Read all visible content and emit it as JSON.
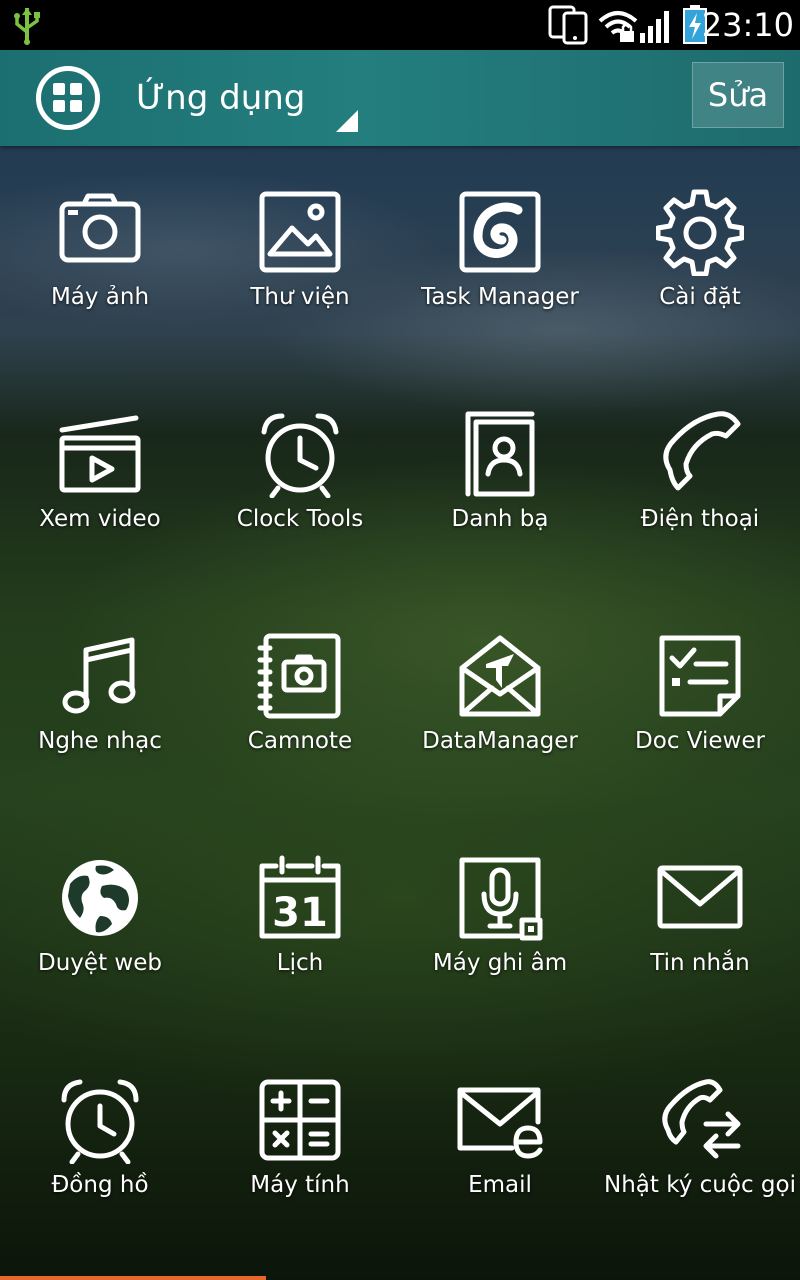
{
  "status_bar": {
    "time": "23:10",
    "icons": [
      "usb-icon",
      "screen-mirroring-icon",
      "wifi-lock-icon",
      "signal-icon",
      "battery-charging-icon"
    ]
  },
  "action_bar": {
    "title": "Ứng dụng",
    "edit_label": "Sửa",
    "accent_color": "#247e7e"
  },
  "apps": [
    {
      "label": "Máy ảnh",
      "icon": "camera-icon"
    },
    {
      "label": "Thư viện",
      "icon": "gallery-icon"
    },
    {
      "label": "Task Manager",
      "icon": "task-manager-icon"
    },
    {
      "label": "Cài đặt",
      "icon": "settings-gear-icon"
    },
    {
      "label": "Xem video",
      "icon": "video-player-icon"
    },
    {
      "label": "Clock Tools",
      "icon": "alarm-clock-icon"
    },
    {
      "label": "Danh bạ",
      "icon": "contacts-icon"
    },
    {
      "label": "Điện thoại",
      "icon": "phone-icon"
    },
    {
      "label": "Nghe nhạc",
      "icon": "music-note-icon"
    },
    {
      "label": "Camnote",
      "icon": "camnote-icon"
    },
    {
      "label": "DataManager",
      "icon": "data-manager-icon"
    },
    {
      "label": "Doc Viewer",
      "icon": "doc-viewer-icon"
    },
    {
      "label": "Duyệt web",
      "icon": "globe-icon"
    },
    {
      "label": "Lịch",
      "icon": "calendar-icon",
      "calendar_day": "31"
    },
    {
      "label": "Máy ghi âm",
      "icon": "voice-recorder-icon"
    },
    {
      "label": "Tin nhắn",
      "icon": "envelope-icon"
    },
    {
      "label": "Đồng hồ",
      "icon": "clock-icon"
    },
    {
      "label": "Máy tính",
      "icon": "calculator-icon"
    },
    {
      "label": "Email",
      "icon": "email-icon"
    },
    {
      "label": "Nhật ký cuộc gọi",
      "icon": "call-log-icon"
    }
  ],
  "page_indicator_color": "#e8672c"
}
